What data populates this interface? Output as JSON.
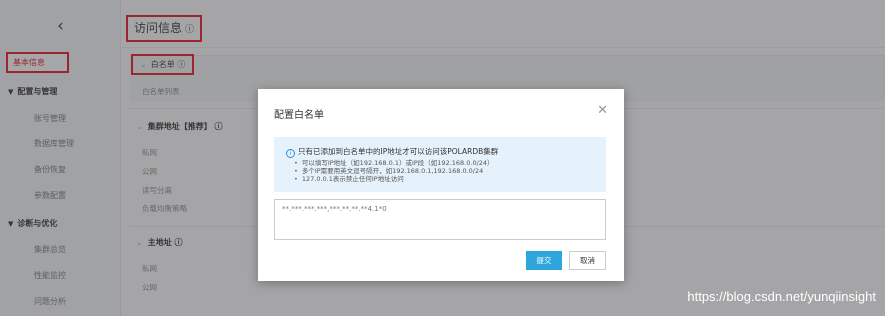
{
  "sidebar": {
    "back_icon": "chevron-left-icon",
    "active_item": "基本信息",
    "groups": [
      {
        "label": "配置与管理",
        "items": [
          "账号管理",
          "数据库管理",
          "备份恢复",
          "参数配置"
        ]
      },
      {
        "label": "诊断与优化",
        "items": [
          "集群总览",
          "性能监控",
          "问题分析"
        ]
      }
    ]
  },
  "main": {
    "page_title": "访问信息",
    "help_icon": "question-circle-icon",
    "whitelist_section": {
      "title": "白名单",
      "list_label": "白名单列表"
    },
    "cluster_section": {
      "title": "集群地址【推荐】",
      "labels": [
        "私网",
        "公网",
        "读写分离",
        "负载均衡策略"
      ]
    },
    "primary_section": {
      "title": "主地址",
      "labels": [
        "私网",
        "公网"
      ]
    }
  },
  "dialog": {
    "title": "配置白名单",
    "close_icon": "close-icon",
    "info_icon": "info-circle-icon",
    "info_head": "只有已添加到白名单中的IP地址才可以访问该POLARDB集群",
    "info_items": [
      "可以填写IP地址（如192.168.0.1）或IP段（如192.168.0.0/24）",
      "多个IP需要用英文逗号隔开，如192.168.0.1,192.168.0.0/24",
      "127.0.0.1表示禁止任何IP地址访问"
    ],
    "textarea_value": "**.***.***.***,***.**.**.**4.1*0",
    "submit_label": "提交",
    "cancel_label": "取消"
  },
  "colors": {
    "highlight": "#e1172b",
    "primary_button": "#2fa6db",
    "info_bg": "#e6f2fb"
  },
  "watermark": "https://blog.csdn.net/yunqiinsight"
}
